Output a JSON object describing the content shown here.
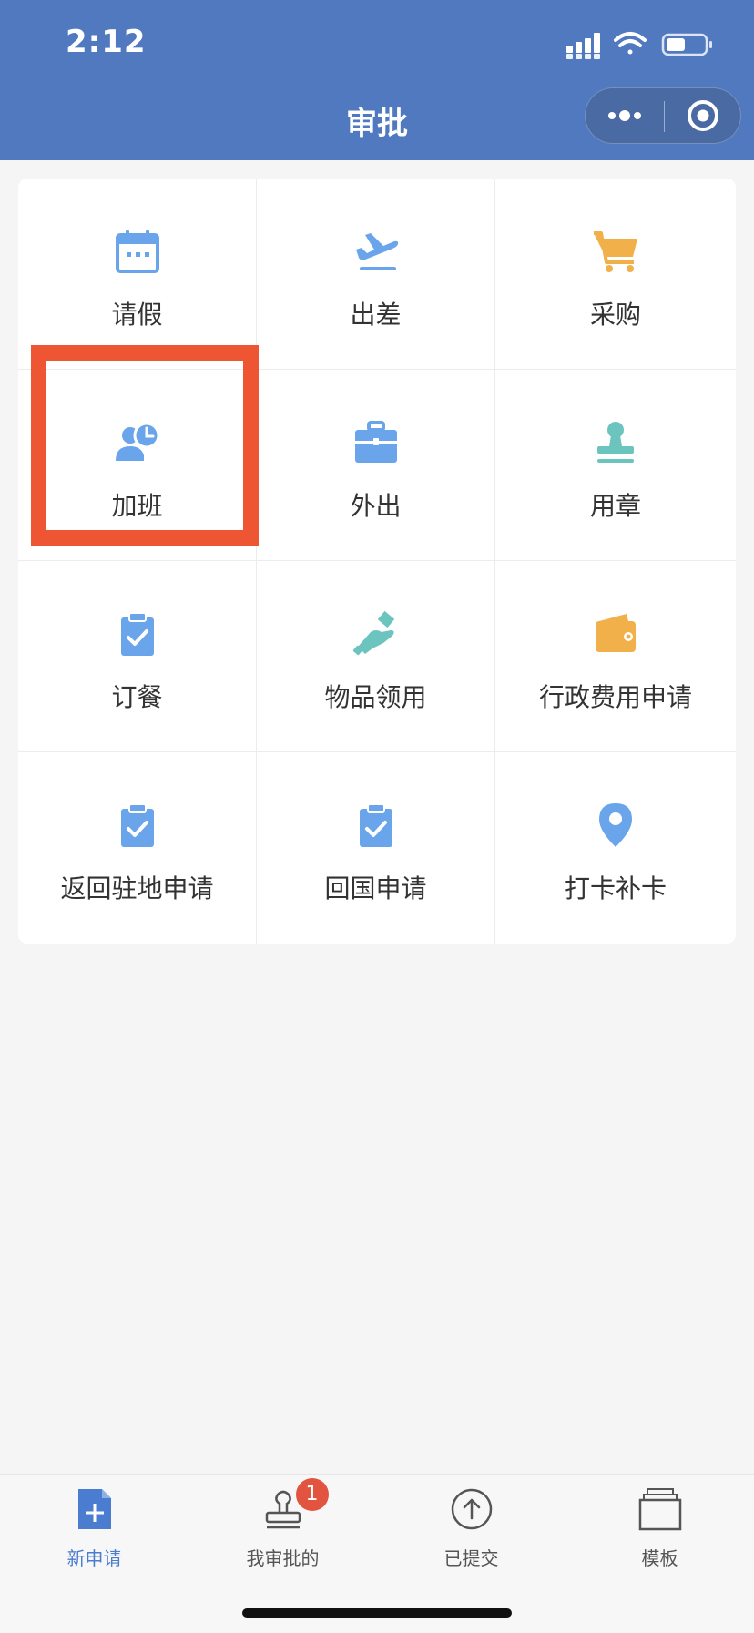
{
  "status_bar": {
    "time": "2:12"
  },
  "header": {
    "title": "审批"
  },
  "grid": [
    {
      "label": "请假",
      "icon": "calendar-icon",
      "color": "#6aa5ec"
    },
    {
      "label": "出差",
      "icon": "airplane-icon",
      "color": "#6aa5ec"
    },
    {
      "label": "采购",
      "icon": "shopping-cart-icon",
      "color": "#f2b04a"
    },
    {
      "label": "加班",
      "icon": "person-clock-icon",
      "color": "#6aa5ec"
    },
    {
      "label": "外出",
      "icon": "briefcase-icon",
      "color": "#6aa5ec"
    },
    {
      "label": "用章",
      "icon": "stamp-icon",
      "color": "#6cc4bf"
    },
    {
      "label": "订餐",
      "icon": "clipboard-check-icon",
      "color": "#6aa5ec"
    },
    {
      "label": "物品领用",
      "icon": "hand-item-icon",
      "color": "#6cc4bf"
    },
    {
      "label": "行政费用申请",
      "icon": "wallet-icon",
      "color": "#f2b04a"
    },
    {
      "label": "返回驻地申请",
      "icon": "clipboard-check-icon",
      "color": "#6aa5ec"
    },
    {
      "label": "回国申请",
      "icon": "clipboard-check-icon",
      "color": "#6aa5ec"
    },
    {
      "label": "打卡补卡",
      "icon": "location-pin-icon",
      "color": "#6aa5ec"
    }
  ],
  "tabbar": [
    {
      "label": "新申请",
      "icon": "new-document-icon",
      "active": true
    },
    {
      "label": "我审批的",
      "icon": "stamp-outline-icon",
      "badge": "1"
    },
    {
      "label": "已提交",
      "icon": "upload-circle-icon"
    },
    {
      "label": "模板",
      "icon": "template-stack-icon"
    }
  ],
  "colors": {
    "header_bg": "#5079c0",
    "highlight": "#ee5533",
    "active_tab": "#4a7ccf",
    "badge": "#e2543f"
  }
}
